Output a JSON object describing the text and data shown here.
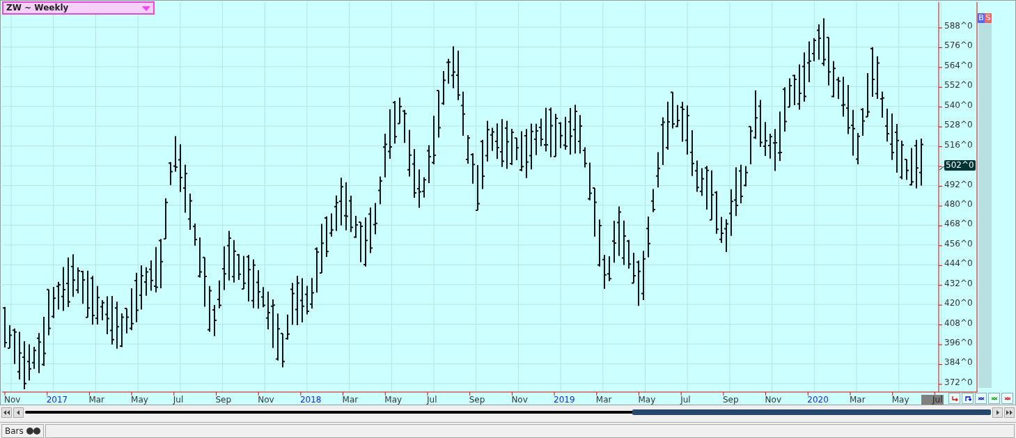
{
  "symbol_selector": {
    "label": "ZW ~ Weekly"
  },
  "trade_buttons": [
    "B",
    "S"
  ],
  "price_axis": {
    "labels": [
      "588^0",
      "576^0",
      "564^0",
      "552^0",
      "540^0",
      "528^0",
      "516^0",
      "492^0",
      "480^0",
      "468^0",
      "456^0",
      "444^0",
      "432^0",
      "420^0",
      "408^0",
      "396^0",
      "384^0",
      "372^0"
    ],
    "current_price": "502^0"
  },
  "time_axis": [
    {
      "label": "Nov",
      "kind": "month"
    },
    {
      "label": "2017",
      "kind": "year"
    },
    {
      "label": "Mar",
      "kind": "month"
    },
    {
      "label": "May",
      "kind": "month"
    },
    {
      "label": "Jul",
      "kind": "month"
    },
    {
      "label": "Sep",
      "kind": "month"
    },
    {
      "label": "Nov",
      "kind": "month"
    },
    {
      "label": "2018",
      "kind": "year"
    },
    {
      "label": "Mar",
      "kind": "month"
    },
    {
      "label": "May",
      "kind": "month"
    },
    {
      "label": "Jul",
      "kind": "month"
    },
    {
      "label": "Sep",
      "kind": "month"
    },
    {
      "label": "Nov",
      "kind": "month"
    },
    {
      "label": "2019",
      "kind": "year"
    },
    {
      "label": "Mar",
      "kind": "month"
    },
    {
      "label": "May",
      "kind": "month"
    },
    {
      "label": "Jul",
      "kind": "month"
    },
    {
      "label": "Sep",
      "kind": "month"
    },
    {
      "label": "Nov",
      "kind": "month"
    },
    {
      "label": "2020",
      "kind": "year"
    },
    {
      "label": "Mar",
      "kind": "month"
    },
    {
      "label": "May",
      "kind": "month"
    },
    {
      "label": "Jul",
      "kind": "current"
    }
  ],
  "status_tabs": [
    {
      "label": "Bars"
    }
  ]
}
